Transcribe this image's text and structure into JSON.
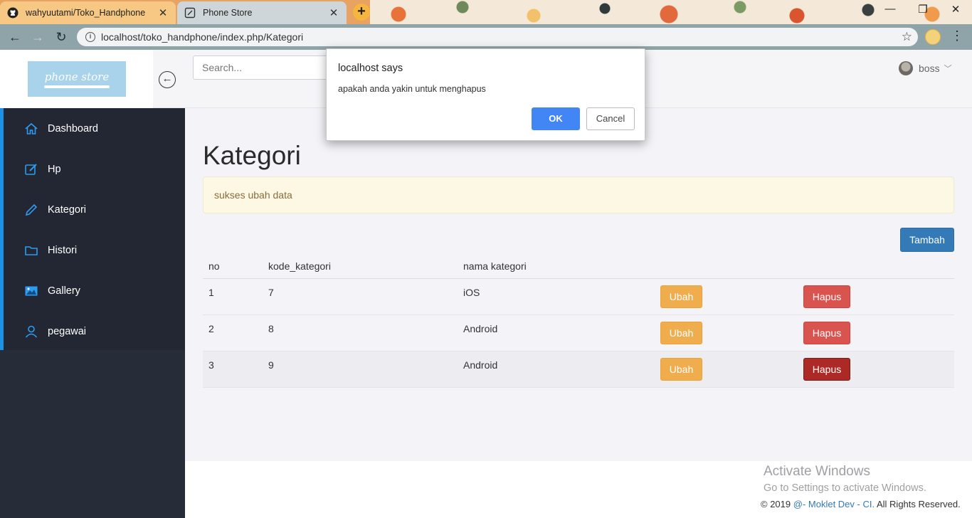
{
  "browser": {
    "tabs": [
      {
        "label": "wahyuutami/Toko_Handphone",
        "icon": "github-icon"
      },
      {
        "label": "Phone Store",
        "icon": "page-icon"
      }
    ],
    "url": "localhost/toko_handphone/index.php/Kategori"
  },
  "header": {
    "logo_text": "phone store",
    "search_placeholder": "Search...",
    "user_name": "boss"
  },
  "sidebar": {
    "items": [
      {
        "label": "Dashboard",
        "icon": "home-icon"
      },
      {
        "label": "Hp",
        "icon": "edit-icon"
      },
      {
        "label": "Kategori",
        "icon": "pencil-icon"
      },
      {
        "label": "Histori",
        "icon": "folder-icon"
      },
      {
        "label": "Gallery",
        "icon": "image-icon"
      },
      {
        "label": "pegawai",
        "icon": "user-icon"
      }
    ],
    "accent_color": "#1c91e6"
  },
  "main": {
    "title": "Kategori",
    "alert": "sukses ubah data",
    "add_button": "Tambah",
    "table": {
      "headers": [
        "no",
        "kode_kategori",
        "nama kategori"
      ],
      "rows": [
        {
          "no": "1",
          "kode": "7",
          "nama": "iOS"
        },
        {
          "no": "2",
          "kode": "8",
          "nama": "Android"
        },
        {
          "no": "3",
          "kode": "9",
          "nama": "Android"
        }
      ],
      "edit_label": "Ubah",
      "delete_label": "Hapus"
    }
  },
  "footer": {
    "year": "© 2019",
    "link": "@- Moklet Dev - CI.",
    "rights": "All Rights Reserved."
  },
  "watermark": {
    "line1": "Activate Windows",
    "line2": "Go to Settings to activate Windows."
  },
  "dialog": {
    "title": "localhost says",
    "message": "apakah anda yakin untuk menghapus",
    "ok": "OK",
    "cancel": "Cancel"
  }
}
